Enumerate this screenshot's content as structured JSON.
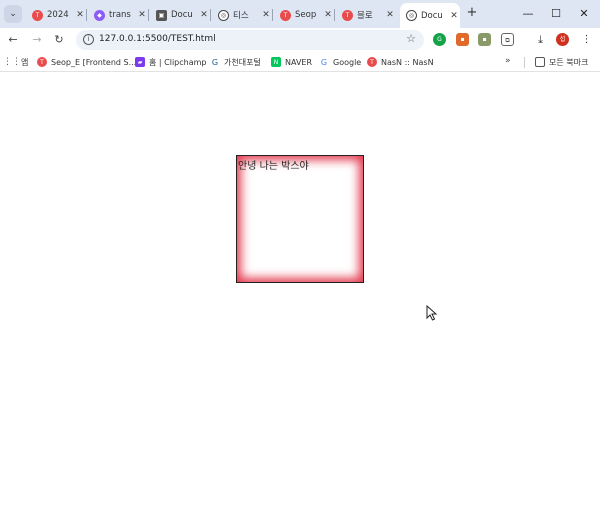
{
  "browser": {
    "tabs": [
      {
        "label": "2024",
        "icon": "tistory-icon",
        "color": "#e94c4c"
      },
      {
        "label": "trans",
        "icon": "translate-icon",
        "color": "#8b5cf6"
      },
      {
        "label": "Docu",
        "icon": "doc-image-icon",
        "color": "#444444"
      },
      {
        "label": "티스",
        "icon": "globe-icon",
        "color": "#444444"
      },
      {
        "label": "Seop",
        "icon": "tistory-icon",
        "color": "#e94c4c"
      },
      {
        "label": "블로",
        "icon": "tistory-icon",
        "color": "#e94c4c"
      },
      {
        "label": "Docu",
        "icon": "globe-icon",
        "color": "#444444",
        "active": true
      }
    ],
    "url": "127.0.0.1:5500/TEST.html",
    "bookmarks": [
      {
        "label": "앱",
        "icon": "apps-grid-icon"
      },
      {
        "label": "Seop_E [Frontend S...",
        "icon": "tistory-icon",
        "color": "#e94c4c"
      },
      {
        "label": "홈 | Clipchamp",
        "icon": "clipchamp-icon",
        "color": "#7c3aed"
      },
      {
        "label": "가천대포털",
        "icon": "gachon-icon",
        "color": "#1e6091"
      },
      {
        "label": "NAVER",
        "icon": "naver-icon",
        "color": "#03c75a"
      },
      {
        "label": "Google",
        "icon": "google-icon",
        "color": "#4285f4"
      },
      {
        "label": "NasN :: NasN",
        "icon": "tistory-icon",
        "color": "#e94c4c"
      }
    ],
    "all_bookmarks_label": "모든 북마크"
  },
  "page": {
    "box_text": "안녕 나는 박스야",
    "box_shadow_color": "#e33a4f"
  }
}
